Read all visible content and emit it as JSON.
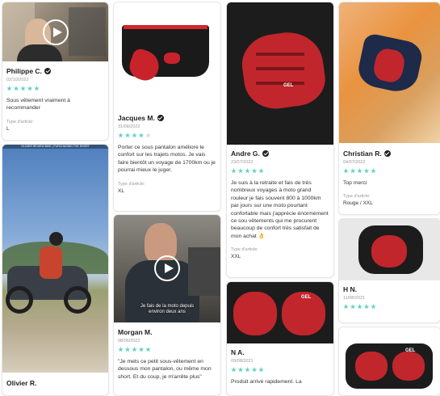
{
  "reviews": [
    {
      "name": "Philippe C.",
      "date": "02/10/2022",
      "text": "Sous vêtement vraiment à recommander",
      "label": "Type d'article:",
      "value": "L",
      "stars": 5
    },
    {
      "name": "Olivier R.",
      "caption": "OLIVIER REVIEW BIKE | PURCHASING THE SHORT"
    },
    {
      "name": "Jacques M.",
      "date": "31/08/2022",
      "text": "Porter ce sous pantalon améliore le confort sur les trajets motos. Je vais faire bientôt un voyage de 1700km ou je pourrai mieux le juger.",
      "label": "Type d'article:",
      "value": "XL",
      "stars": 4
    },
    {
      "name": "Morgan M.",
      "date": "08/06/2022",
      "text": "\"Je mets ce petit sous-vêtement en dessous mon pantalon, ou même mon short. Et du coup, je m'arrête plus\"",
      "subtitle": "Je fais de la moto depuis environ deux ans",
      "stars": 5
    },
    {
      "name": "Andre G.",
      "date": "23/07/2022",
      "text": "Je suis à la retraite et fais de très nombreux voyages à moto grand rouleur je fais souvent 800 à 1000km par jours sur une moto pourtant confortable mais j'apprécie énormément ce sou vêtements qui me procurent beaucoup de confort très satisfait de mon achat 👌",
      "label": "Type d'article:",
      "value": "XXL",
      "stars": 5
    },
    {
      "name": "N A.",
      "date": "09/08/2021",
      "text": "Produit arrivé rapidement. La",
      "stars": 5
    },
    {
      "name": "Christian R.",
      "date": "04/07/2022",
      "text": "Top merci",
      "label": "Type d'article:",
      "value": "Rouge / XXL",
      "stars": 5
    },
    {
      "name": "H N.",
      "date": "11/08/2021",
      "stars": 5
    }
  ],
  "colors": {
    "star": "#63d0c0",
    "brand": "#222222"
  }
}
